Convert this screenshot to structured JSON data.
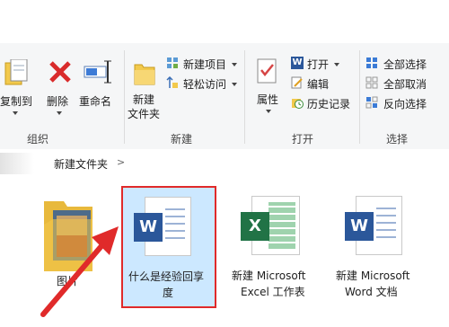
{
  "ribbon": {
    "organize": {
      "group_label": "组织",
      "copy_to": "复制到",
      "delete": "删除",
      "rename": "重命名"
    },
    "new": {
      "group_label": "新建",
      "new_folder_line1": "新建",
      "new_folder_line2": "文件夹",
      "new_item": "新建项目",
      "easy_access": "轻松访问"
    },
    "open": {
      "group_label": "打开",
      "properties": "属性",
      "open": "打开",
      "edit": "编辑",
      "history": "历史记录"
    },
    "select": {
      "group_label": "选择",
      "select_all": "全部选择",
      "select_none": "全部取消",
      "invert": "反向选择"
    }
  },
  "address": {
    "path": "新建文件夹",
    "separator": ">"
  },
  "files": [
    {
      "name": "图片",
      "type": "folder"
    },
    {
      "name_line1": "什么是经验回享",
      "name_line2": "度",
      "type": "word",
      "selected": true
    },
    {
      "name_line1": "新建 Microsoft",
      "name_line2": "Excel 工作表",
      "type": "excel"
    },
    {
      "name_line1": "新建 Microsoft",
      "name_line2": "Word 文档",
      "type": "word"
    }
  ],
  "icons": {
    "word_letter": "W",
    "excel_letter": "X"
  },
  "colors": {
    "word_blue": "#2b579a",
    "excel_green": "#217346",
    "selection_fill": "#cce8ff",
    "annotation_red": "#e02a2a",
    "delete_red": "#d92b2b"
  }
}
